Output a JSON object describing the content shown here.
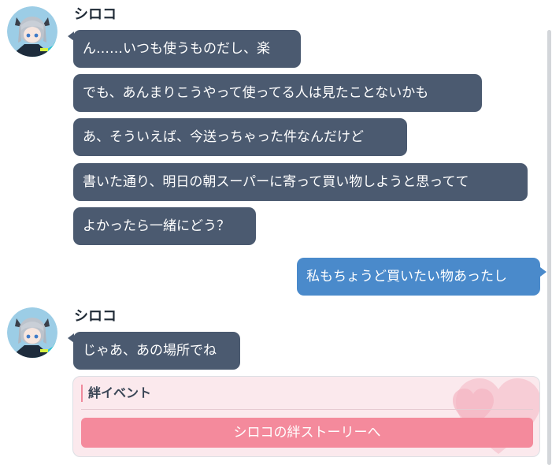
{
  "colors": {
    "incoming_bubble": "#4b5a70",
    "outgoing_bubble": "#4a8acb",
    "bond_card_background": "#fbe9ed",
    "bond_button": "#f48a9c",
    "bond_accent": "#f08a9c"
  },
  "groups": [
    {
      "sender": "シロコ",
      "messages": [
        "ん……いつも使うものだし、楽",
        "でも、あんまりこうやって使ってる人は見たことないかも",
        "あ、そういえば、今送っちゃった件なんだけど",
        "書いた通り、明日の朝スーパーに寄って買い物しようと思ってて",
        "よかったら一緒にどう？"
      ]
    },
    {
      "sender": "シロコ",
      "messages": [
        "じゃあ、あの場所でね"
      ]
    }
  ],
  "outgoing": {
    "message": "私もちょうど買いたい物あったし"
  },
  "bond_event": {
    "title": "絆イベント",
    "button_label": "シロコの絆ストーリーへ"
  }
}
